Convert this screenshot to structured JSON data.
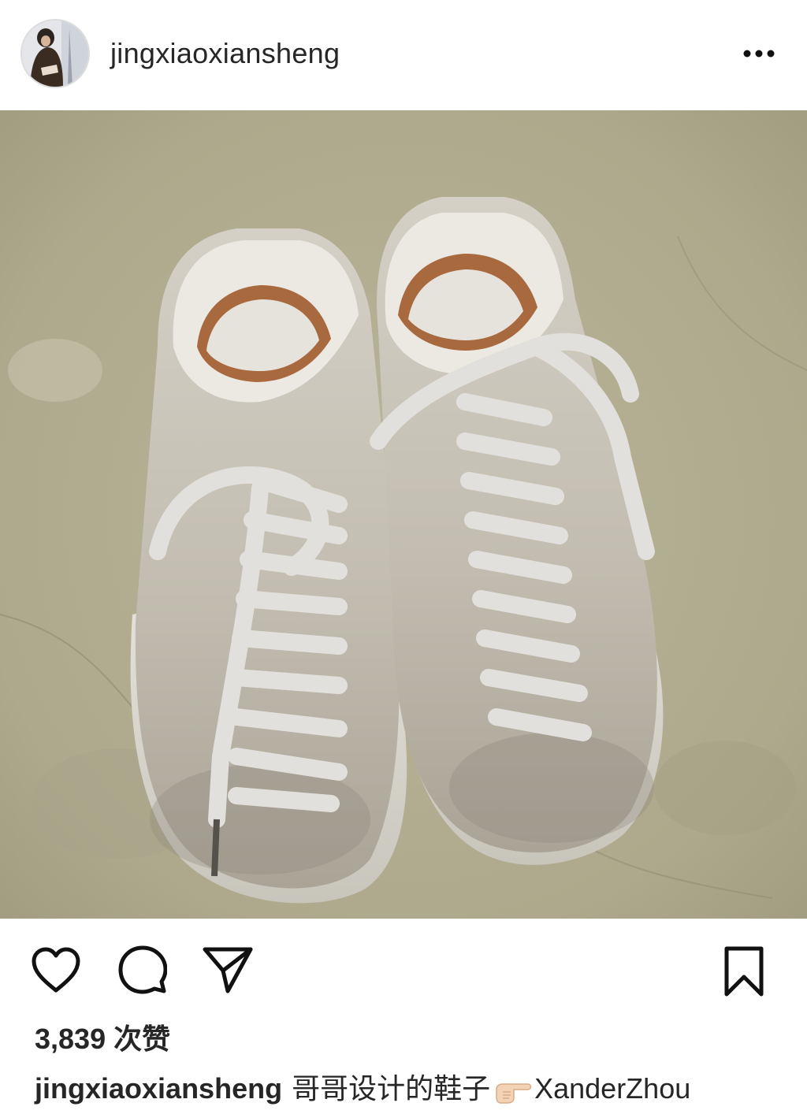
{
  "post": {
    "username": "jingxiaoxiansheng",
    "more_label": "more-options",
    "likes_text": "3,839 次赞",
    "caption": {
      "username": "jingxiaoxiansheng",
      "text_before": "哥哥设计的鞋子",
      "emoji": "backhand-index-pointing-right",
      "text_after": "XanderZhou"
    }
  },
  "icons": {
    "like": "heart-icon",
    "comment": "comment-bubble-icon",
    "share": "paper-plane-icon",
    "save": "bookmark-icon",
    "more": "ellipsis-icon"
  },
  "colors": {
    "text": "#262626",
    "background": "#ffffff",
    "icon": "#111111"
  }
}
